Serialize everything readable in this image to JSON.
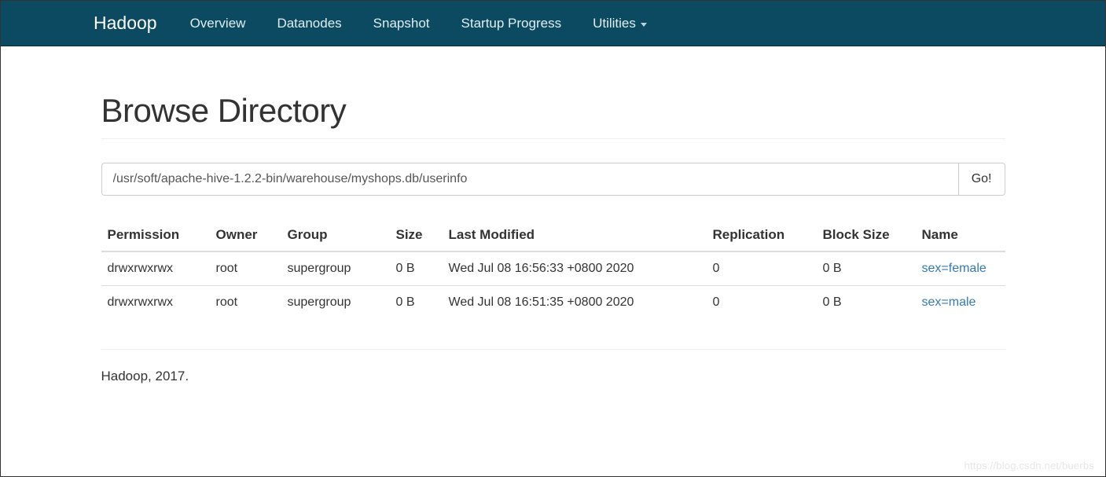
{
  "navbar": {
    "brand": "Hadoop",
    "items": [
      "Overview",
      "Datanodes",
      "Snapshot",
      "Startup Progress",
      "Utilities"
    ]
  },
  "page": {
    "title": "Browse Directory"
  },
  "path": {
    "value": "/usr/soft/apache-hive-1.2.2-bin/warehouse/myshops.db/userinfo",
    "go_label": "Go!"
  },
  "table": {
    "headers": {
      "permission": "Permission",
      "owner": "Owner",
      "group": "Group",
      "size": "Size",
      "last_modified": "Last Modified",
      "replication": "Replication",
      "block_size": "Block Size",
      "name": "Name"
    },
    "rows": [
      {
        "permission": "drwxrwxrwx",
        "owner": "root",
        "group": "supergroup",
        "size": "0 B",
        "last_modified": "Wed Jul 08 16:56:33 +0800 2020",
        "replication": "0",
        "block_size": "0 B",
        "name": "sex=female"
      },
      {
        "permission": "drwxrwxrwx",
        "owner": "root",
        "group": "supergroup",
        "size": "0 B",
        "last_modified": "Wed Jul 08 16:51:35 +0800 2020",
        "replication": "0",
        "block_size": "0 B",
        "name": "sex=male"
      }
    ]
  },
  "footer": {
    "text": "Hadoop, 2017."
  },
  "watermark": "https://blog.csdn.net/buerbs"
}
